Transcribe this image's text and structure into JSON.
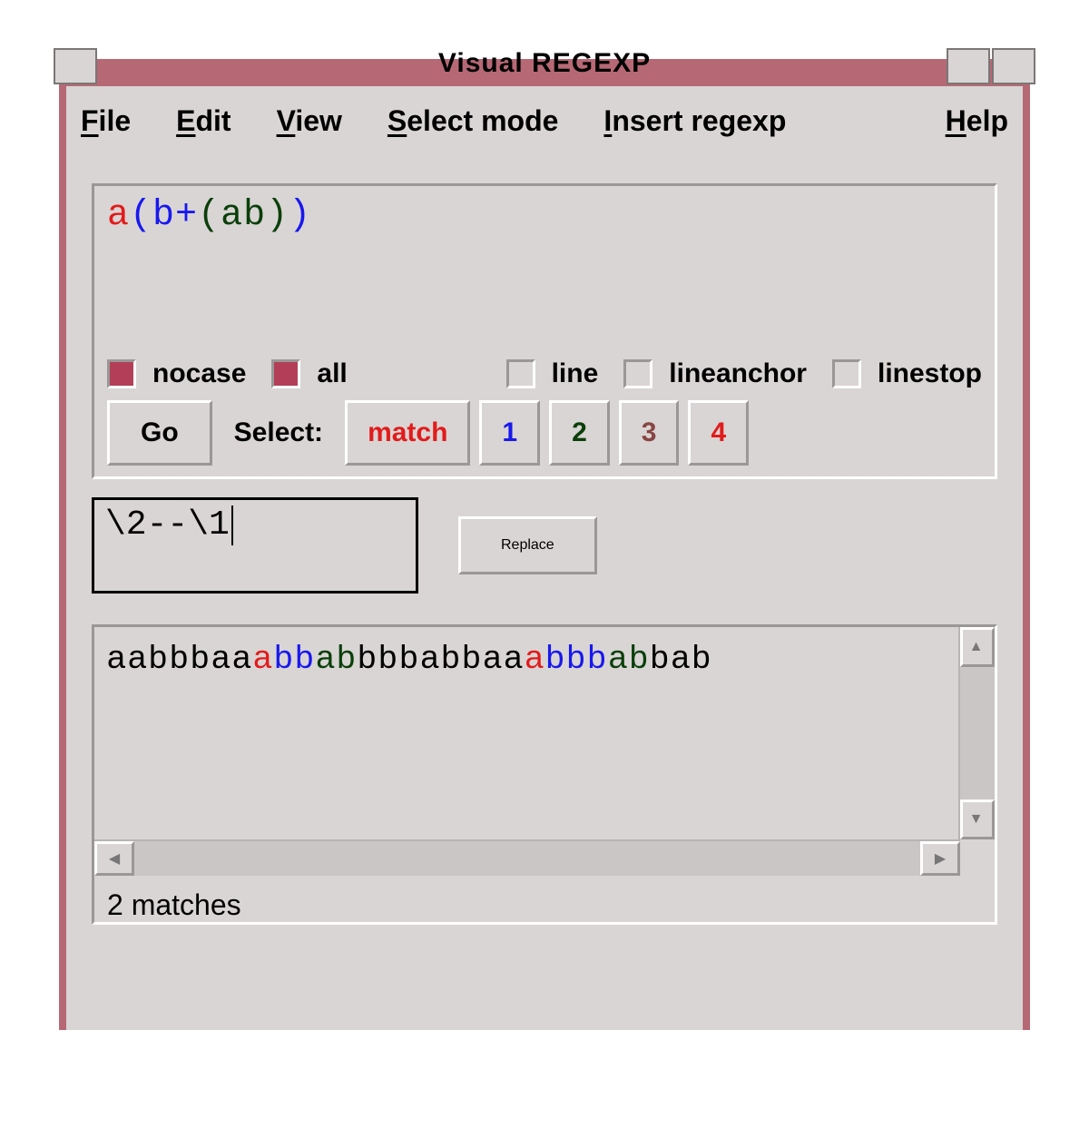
{
  "title": "Visual REGEXP",
  "menu": {
    "file": "File",
    "edit": "Edit",
    "view": "View",
    "selectmode": "Select mode",
    "insert": "Insert regexp",
    "help": "Help"
  },
  "regex_tokens": [
    {
      "t": "a",
      "c": "c-red"
    },
    {
      "t": "(",
      "c": "c-blue"
    },
    {
      "t": "b+",
      "c": "c-blue"
    },
    {
      "t": "(",
      "c": "c-dgr"
    },
    {
      "t": "ab",
      "c": "c-dgr"
    },
    {
      "t": ")",
      "c": "c-dgr"
    },
    {
      "t": ")",
      "c": "c-blue"
    }
  ],
  "flags": {
    "nocase": "nocase",
    "all": "all",
    "line": "line",
    "lineanchor": "lineanchor",
    "linestop": "linestop"
  },
  "checked": {
    "nocase": true,
    "all": true,
    "line": false,
    "lineanchor": false,
    "linestop": false
  },
  "go": "Go",
  "select_label": "Select:",
  "select_buttons": [
    {
      "t": "match",
      "c": "c-red"
    },
    {
      "t": "1",
      "c": "c-blue"
    },
    {
      "t": "2",
      "c": "c-dgr"
    },
    {
      "t": "3",
      "c": "c-brown"
    },
    {
      "t": "4",
      "c": "c-red"
    }
  ],
  "replace_value": "\\2--\\1",
  "replace_label": "Replace",
  "sample_tokens": [
    {
      "t": "aabbbaa",
      "c": "c-black"
    },
    {
      "t": "a",
      "c": "c-red"
    },
    {
      "t": "bb",
      "c": "c-blue"
    },
    {
      "t": "ab",
      "c": "c-dgr"
    },
    {
      "t": "bbbabbaa",
      "c": "c-black"
    },
    {
      "t": "a",
      "c": "c-red"
    },
    {
      "t": "bbb",
      "c": "c-blue"
    },
    {
      "t": "ab",
      "c": "c-dgr"
    },
    {
      "t": "bab",
      "c": "c-black"
    }
  ],
  "status": "2 matches"
}
